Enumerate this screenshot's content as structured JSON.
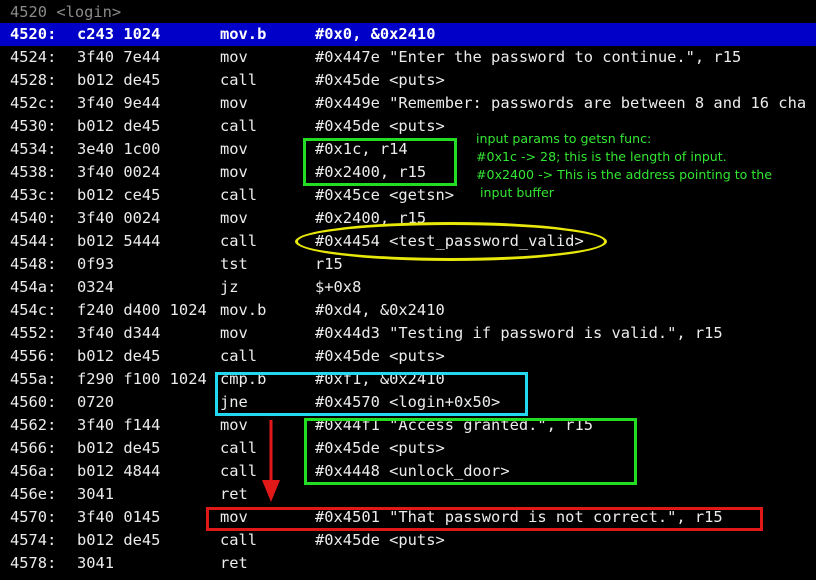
{
  "header": {
    "label": "4520 <login>"
  },
  "rows": [
    {
      "addr": "4520:",
      "bytes": "c243 1024",
      "mnem": "mov.b",
      "ops": "#0x0, &0x2410"
    },
    {
      "addr": "4524:",
      "bytes": "3f40 7e44",
      "mnem": "mov",
      "ops": "#0x447e \"Enter the password to continue.\", r15"
    },
    {
      "addr": "4528:",
      "bytes": "b012 de45",
      "mnem": "call",
      "ops": "#0x45de <puts>"
    },
    {
      "addr": "452c:",
      "bytes": "3f40 9e44",
      "mnem": "mov",
      "ops": "#0x449e \"Remember: passwords are between 8 and 16 cha"
    },
    {
      "addr": "4530:",
      "bytes": "b012 de45",
      "mnem": "call",
      "ops": "#0x45de <puts>"
    },
    {
      "addr": "4534:",
      "bytes": "3e40 1c00",
      "mnem": "mov",
      "ops": "#0x1c, r14"
    },
    {
      "addr": "4538:",
      "bytes": "3f40 0024",
      "mnem": "mov",
      "ops": "#0x2400, r15"
    },
    {
      "addr": "453c:",
      "bytes": "b012 ce45",
      "mnem": "call",
      "ops": "#0x45ce <getsn>"
    },
    {
      "addr": "4540:",
      "bytes": "3f40 0024",
      "mnem": "mov",
      "ops": "#0x2400, r15"
    },
    {
      "addr": "4544:",
      "bytes": "b012 5444",
      "mnem": "call",
      "ops": "#0x4454 <test_password_valid>"
    },
    {
      "addr": "4548:",
      "bytes": "0f93",
      "mnem": "tst",
      "ops": "r15"
    },
    {
      "addr": "454a:",
      "bytes": "0324",
      "mnem": "jz",
      "ops": "$+0x8"
    },
    {
      "addr": "454c:",
      "bytes": "f240 d400 1024",
      "mnem": "mov.b",
      "ops": "#0xd4, &0x2410"
    },
    {
      "addr": "4552:",
      "bytes": "3f40 d344",
      "mnem": "mov",
      "ops": "#0x44d3 \"Testing if password is valid.\", r15"
    },
    {
      "addr": "4556:",
      "bytes": "b012 de45",
      "mnem": "call",
      "ops": "#0x45de <puts>"
    },
    {
      "addr": "455a:",
      "bytes": "f290 f100 1024",
      "mnem": "cmp.b",
      "ops": "#0xf1, &0x2410"
    },
    {
      "addr": "4560:",
      "bytes": "0720",
      "mnem": "jne",
      "ops": "#0x4570 <login+0x50>"
    },
    {
      "addr": "4562:",
      "bytes": "3f40 f144",
      "mnem": "mov",
      "ops": "#0x44f1 \"Access granted.\", r15"
    },
    {
      "addr": "4566:",
      "bytes": "b012 de45",
      "mnem": "call",
      "ops": "#0x45de <puts>"
    },
    {
      "addr": "456a:",
      "bytes": "b012 4844",
      "mnem": "call",
      "ops": "#0x4448 <unlock_door>"
    },
    {
      "addr": "456e:",
      "bytes": "3041",
      "mnem": "ret",
      "ops": ""
    },
    {
      "addr": "4570:",
      "bytes": "3f40 0145",
      "mnem": "mov",
      "ops": "#0x4501 \"That password is not correct.\", r15"
    },
    {
      "addr": "4574:",
      "bytes": "b012 de45",
      "mnem": "call",
      "ops": "#0x45de <puts>"
    },
    {
      "addr": "4578:",
      "bytes": "3041",
      "mnem": "ret",
      "ops": ""
    }
  ],
  "annotation": {
    "lines": [
      "input params to getsn func:",
      "#0x1c -> 28; this is the length of input.",
      "#0x2400 -> This is the address pointing to the",
      " input buffer"
    ]
  },
  "colors": {
    "current_line_bg": "#0000c8",
    "annotation_text": "#33e633",
    "green_box": "#22dd22",
    "cyan_box": "#22d8f0",
    "yellow_ellipse": "#e8e80a",
    "red_box": "#e01818",
    "arrow": "#e01818"
  }
}
